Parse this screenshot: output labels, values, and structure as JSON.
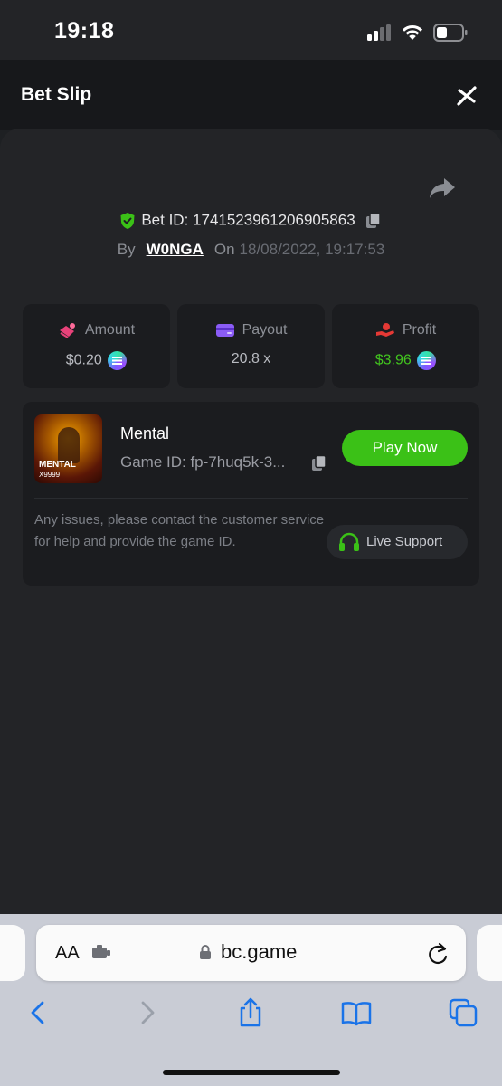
{
  "status_bar": {
    "time": "19:18"
  },
  "header": {
    "title": "Bet Slip"
  },
  "bet": {
    "bet_id_label": "Bet ID:",
    "bet_id": "1741523961206905863",
    "by_label": "By",
    "user": "W0NGA",
    "on_label": "On",
    "date": "18/08/2022, 19:17:53"
  },
  "stats": {
    "amount": {
      "label": "Amount",
      "value": "$0.20"
    },
    "payout": {
      "label": "Payout",
      "value": "20.8 x"
    },
    "profit": {
      "label": "Profit",
      "value": "$3.96"
    }
  },
  "game": {
    "thumb_title": "MENTAL",
    "thumb_sub": "X9999",
    "name": "Mental",
    "id_text": "Game ID: fp-7huq5k-3...",
    "play_label": "Play Now",
    "help_text": "Any issues, please contact the customer service for help and provide the game ID.",
    "support_label": "Live Support"
  },
  "browser": {
    "aa_label": "AA",
    "url": "bc.game"
  },
  "colors": {
    "accent_green": "#3bc117",
    "profit_green": "#42c41f",
    "background": "#232427"
  }
}
